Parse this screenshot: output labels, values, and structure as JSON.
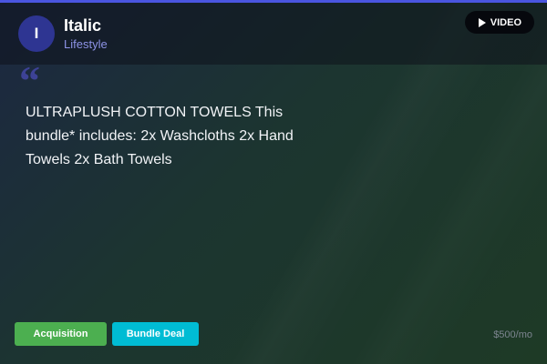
{
  "brand": {
    "initial": "I",
    "name": "Italic",
    "category": "Lifestyle"
  },
  "header": {
    "video_label": "VIDEO",
    "video_icon": "play-icon"
  },
  "quote": {
    "mark": "“",
    "text": "ULTRAPLUSH COTTON TOWELS This bundle* includes: 2x Washcloths 2x Hand Towels 2x Bath Towels"
  },
  "tags": [
    {
      "label": "Acquisition",
      "color": "#4caf50"
    },
    {
      "label": "Bundle Deal",
      "color": "#00bcd4"
    }
  ],
  "price": "$500/mo",
  "colors": {
    "accent": "#4a55e0",
    "avatar": "#2e3592",
    "category_text": "#8d93e6"
  }
}
